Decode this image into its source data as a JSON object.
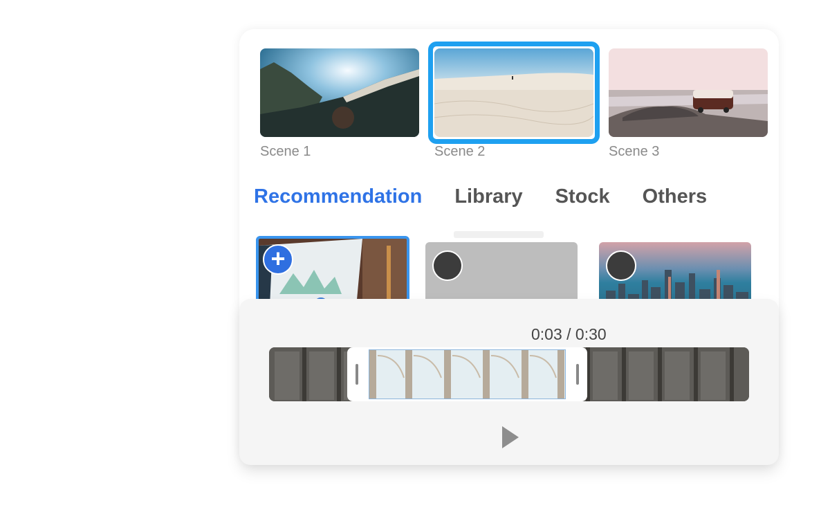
{
  "scenes": [
    {
      "label": "Scene 1",
      "image": "mountain-sky-photo",
      "selected": false
    },
    {
      "label": "Scene 2",
      "image": "desert-dunes-photo",
      "selected": true
    },
    {
      "label": "Scene 3",
      "image": "van-on-beach-photo",
      "selected": false
    }
  ],
  "tabs": [
    {
      "label": "Recommendation",
      "active": true
    },
    {
      "label": "Library",
      "active": false
    },
    {
      "label": "Stock",
      "active": false
    },
    {
      "label": "Others",
      "active": false
    }
  ],
  "media": [
    {
      "image": "laptop-dashboard-photo",
      "action": "add",
      "selected": true
    },
    {
      "image": "placeholder-gray",
      "action": "select",
      "selected": false
    },
    {
      "image": "city-skyline-photo",
      "action": "select",
      "selected": false
    }
  ],
  "player": {
    "time": "0:03 / 0:30",
    "current_seconds": 3,
    "total_seconds": 30,
    "play_icon": "play-icon"
  },
  "colors": {
    "accent": "#2f73e6",
    "selection": "#1ea0f0"
  }
}
